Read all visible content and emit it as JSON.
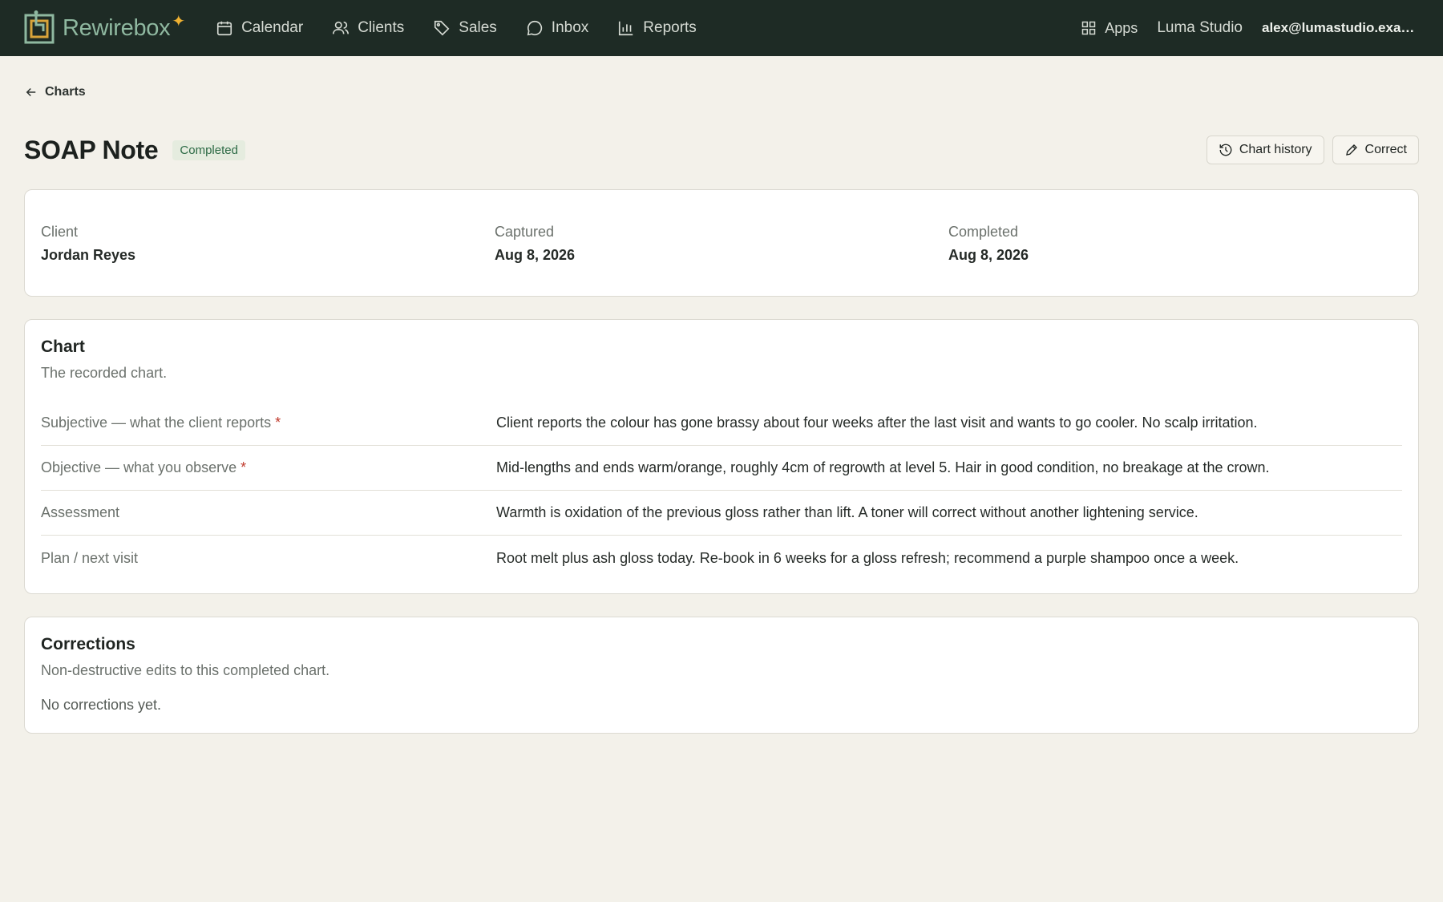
{
  "app": {
    "brand": "Rewirebox",
    "nav": [
      {
        "label": "Calendar",
        "icon": "calendar-icon"
      },
      {
        "label": "Clients",
        "icon": "users-icon"
      },
      {
        "label": "Sales",
        "icon": "tag-icon"
      },
      {
        "label": "Inbox",
        "icon": "chat-bubble-icon"
      },
      {
        "label": "Reports",
        "icon": "bar-chart-icon"
      }
    ],
    "apps_label": "Apps",
    "studio": "Luma Studio",
    "user_email": "alex@lumastudio.exam..."
  },
  "breadcrumb": {
    "back_label": "Charts"
  },
  "header": {
    "title": "SOAP Note",
    "status": "Completed",
    "history_button": "Chart history",
    "correct_button": "Correct"
  },
  "meta": [
    {
      "label": "Client",
      "value": "Jordan Reyes"
    },
    {
      "label": "Captured",
      "value": "Aug 8, 2026"
    },
    {
      "label": "Completed",
      "value": "Aug 8, 2026"
    }
  ],
  "chart": {
    "title": "Chart",
    "subtitle": "The recorded chart.",
    "fields": [
      {
        "label": "Subjective — what the client reports",
        "required": "*",
        "value": "Client reports the colour has gone brassy about four weeks after the last visit and wants to go cooler. No scalp irritation."
      },
      {
        "label": "Objective — what you observe",
        "required": "*",
        "value": "Mid-lengths and ends warm/orange, roughly 4cm of regrowth at level 5. Hair in good condition, no breakage at the crown."
      },
      {
        "label": "Assessment",
        "required": "",
        "value": "Warmth is oxidation of the previous gloss rather than lift. A toner will correct without another lightening service."
      },
      {
        "label": "Plan / next visit",
        "required": "",
        "value": "Root melt plus ash gloss today. Re-book in 6 weeks for a gloss refresh; recommend a purple shampoo once a week."
      }
    ]
  },
  "corrections": {
    "title": "Corrections",
    "subtitle": "Non-destructive edits to this completed chart.",
    "empty": "No corrections yet."
  },
  "colors": {
    "topbar": "#1e2b25",
    "background": "#f3f1ea",
    "brand_accent": "#8fb8a0",
    "star": "#f0b232",
    "badge_text": "#2c6a45",
    "required": "#c0392b"
  }
}
